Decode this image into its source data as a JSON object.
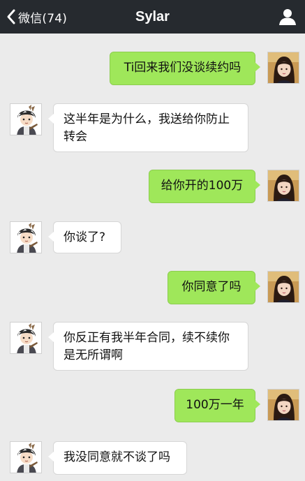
{
  "navbar": {
    "back_label": "微信(74)",
    "title": "Sylar"
  },
  "messages": [
    {
      "side": "sent",
      "text": "Ti回来我们没谈续约吗"
    },
    {
      "side": "received",
      "text": "这半年是为什么，我送给你防止转会"
    },
    {
      "side": "sent",
      "text": "给你开的100万"
    },
    {
      "side": "received",
      "text": "你谈了?"
    },
    {
      "side": "sent",
      "text": "你同意了吗"
    },
    {
      "side": "received",
      "text": "你反正有我半年合同，续不续你是无所谓啊"
    },
    {
      "side": "sent",
      "text": "100万一年"
    },
    {
      "side": "received",
      "text": "我没同意就不谈了吗"
    }
  ],
  "colors": {
    "navbar": "#262a2f",
    "background": "#ebebeb",
    "sent_bubble": "#9fe75a",
    "received_bubble": "#ffffff"
  },
  "icons": {
    "back": "chevron-left-icon",
    "profile": "person-icon"
  }
}
